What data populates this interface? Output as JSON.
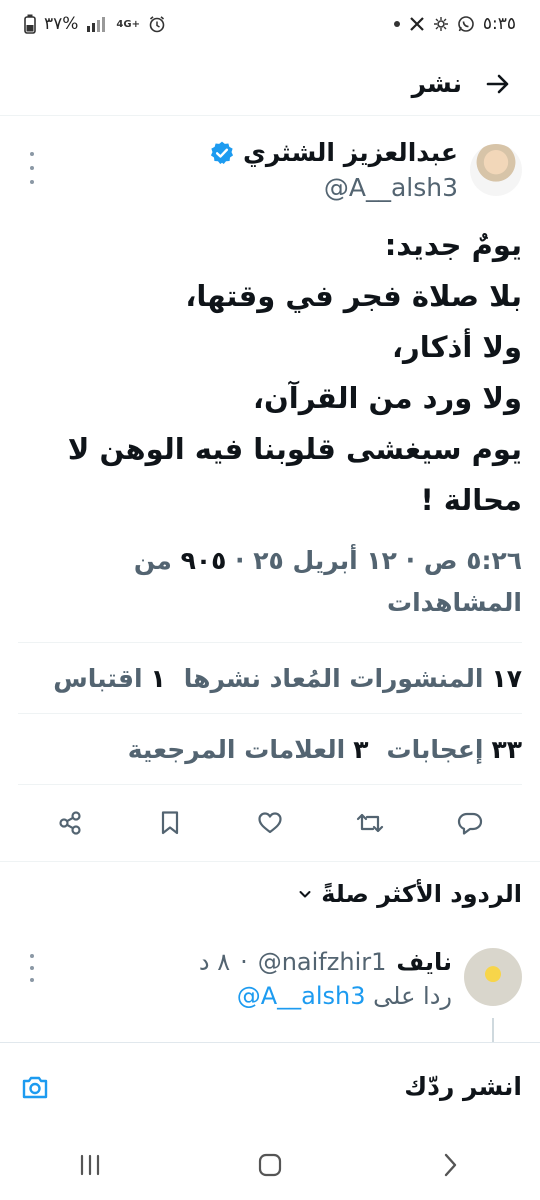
{
  "status_bar": {
    "time": "٥:٣٥",
    "battery": "٣٧%",
    "network": "4G+",
    "colors": {
      "text": "#222222"
    }
  },
  "header": {
    "title": "نشر",
    "back_icon": "arrow-right-icon"
  },
  "tweet": {
    "author_name": "عبدالعزيز الشثري",
    "author_handle": "@A__alsh3",
    "verified_icon": "verified-badge-icon",
    "text": "يومٌ جديد:\nبلا صلاة فجر في وقتها،\nولا أذكار،\nولا ورد من القرآن،\nيوم سيغشى قلوبنا فيه الوهن لا\nمحالة !",
    "time": "٥:٢٦ ص",
    "date": "١٢ أبريل ٢٥",
    "views_count": "٩٠٥",
    "views_label": "من المشاهدات",
    "reposts_count": "١٧",
    "reposts_label": "المنشورات المُعاد نشرها",
    "quotes_count": "١",
    "quotes_label": "اقتباس",
    "likes_count": "٣٣",
    "likes_label": "إعجابات",
    "bookmarks_count": "٣",
    "bookmarks_label": "العلامات المرجعية"
  },
  "replies": {
    "sort_label": "الردود الأكثر صلةً",
    "items": [
      {
        "name": "نايف",
        "handle": "@naifzhir1",
        "time": "٨ د",
        "replying_to_prefix": "ردا على",
        "replying_to_handle": "@A__alsh3"
      }
    ]
  },
  "reply_bar": {
    "placeholder": "انشر ردّك"
  },
  "colors": {
    "accent": "#1d9bf0",
    "muted": "#536471",
    "text": "#0f1419",
    "divider": "#eff3f4"
  }
}
